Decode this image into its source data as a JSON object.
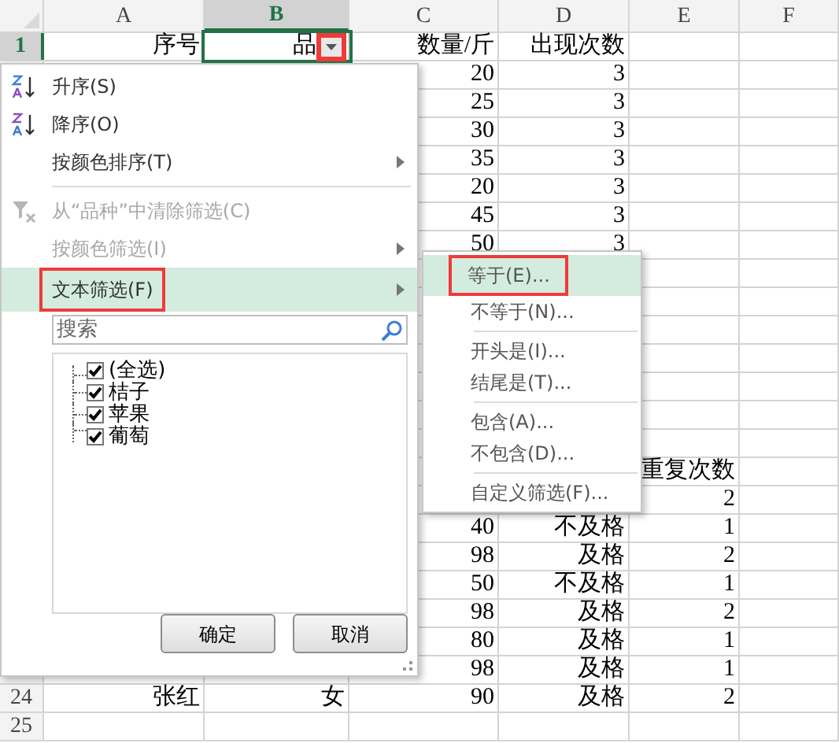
{
  "sheet": {
    "columns": [
      {
        "label": "A",
        "selected": false
      },
      {
        "label": "B",
        "selected": true
      },
      {
        "label": "C",
        "selected": false
      },
      {
        "label": "D",
        "selected": false
      },
      {
        "label": "E",
        "selected": false
      },
      {
        "label": "F",
        "selected": false
      }
    ],
    "rows": [
      {
        "number": "1",
        "selected": true,
        "cells": {
          "a": "序号",
          "b": "品",
          "c": "数量/斤",
          "d": "出现次数"
        }
      },
      {
        "cells": {
          "c": "20",
          "d": "3"
        }
      },
      {
        "cells": {
          "c": "25",
          "d": "3"
        }
      },
      {
        "cells": {
          "c": "30",
          "d": "3"
        }
      },
      {
        "cells": {
          "c": "35",
          "d": "3"
        }
      },
      {
        "cells": {
          "c": "20",
          "d": "3"
        }
      },
      {
        "cells": {
          "c": "45",
          "d": "3"
        }
      },
      {
        "cells": {
          "c": "50",
          "d": "3"
        }
      },
      {
        "cells": {}
      },
      {
        "cells": {}
      },
      {
        "cells": {}
      },
      {
        "cells": {}
      },
      {
        "cells": {}
      },
      {
        "cells": {}
      },
      {
        "cells": {}
      },
      {
        "cells": {
          "e": "重复次数"
        }
      },
      {
        "cells": {
          "e": "2"
        }
      },
      {
        "cells": {
          "c": "40",
          "d": "不及格",
          "e": "1"
        }
      },
      {
        "cells": {
          "c": "98",
          "d": "及格",
          "e": "2"
        }
      },
      {
        "cells": {
          "c": "50",
          "d": "不及格",
          "e": "1"
        }
      },
      {
        "cells": {
          "c": "98",
          "d": "及格",
          "e": "2"
        }
      },
      {
        "cells": {
          "c": "80",
          "d": "及格",
          "e": "1"
        }
      },
      {
        "cells": {
          "c": "98",
          "d": "及格",
          "e": "1"
        }
      },
      {
        "number": "24",
        "selected": false,
        "cells": {
          "a": "张红",
          "b": "女",
          "c": "90",
          "d": "及格",
          "e": "2"
        }
      },
      {
        "number": "25",
        "selected": false,
        "cells": {}
      }
    ],
    "filter_button": {
      "marked": true
    }
  },
  "filter_menu": {
    "items": [
      {
        "kind": "sort-ascending",
        "label": "升序(S)",
        "disabled": false,
        "submenu": false,
        "highlighted": false,
        "marked": false
      },
      {
        "kind": "sort-descending",
        "label": "降序(O)",
        "disabled": false,
        "submenu": false,
        "highlighted": false,
        "marked": false
      },
      {
        "kind": "item",
        "label": "按颜色排序(T)",
        "disabled": false,
        "submenu": true,
        "highlighted": false,
        "marked": false
      },
      {
        "kind": "separator"
      },
      {
        "kind": "clear-filter",
        "label": "从“品种”中清除筛选(C)",
        "disabled": true,
        "submenu": false,
        "highlighted": false,
        "marked": false
      },
      {
        "kind": "item",
        "label": "按颜色筛选(I)",
        "disabled": true,
        "submenu": true,
        "highlighted": false,
        "marked": false
      },
      {
        "kind": "item",
        "label": "文本筛选(F)",
        "disabled": false,
        "submenu": true,
        "highlighted": true,
        "marked": true
      }
    ],
    "search": {
      "placeholder": "搜索"
    },
    "values": [
      {
        "label": "(全选)",
        "checked": true
      },
      {
        "label": "桔子",
        "checked": true
      },
      {
        "label": "苹果",
        "checked": true
      },
      {
        "label": "葡萄",
        "checked": true
      }
    ],
    "buttons": [
      "确定",
      "取消"
    ]
  },
  "text_filter_menu": {
    "items": [
      {
        "kind": "item",
        "label": "等于(E)...",
        "highlighted": true,
        "marked": true
      },
      {
        "kind": "item",
        "label": "不等于(N)...",
        "highlighted": false,
        "marked": false
      },
      {
        "kind": "separator"
      },
      {
        "kind": "item",
        "label": "开头是(I)...",
        "highlighted": false,
        "marked": false
      },
      {
        "kind": "item",
        "label": "结尾是(T)...",
        "highlighted": false,
        "marked": false
      },
      {
        "kind": "separator"
      },
      {
        "kind": "item",
        "label": "包含(A)...",
        "highlighted": false,
        "marked": false
      },
      {
        "kind": "item",
        "label": "不包含(D)...",
        "highlighted": false,
        "marked": false
      },
      {
        "kind": "separator"
      },
      {
        "kind": "item",
        "label": "自定义筛选(F)...",
        "highlighted": false,
        "marked": false
      }
    ]
  }
}
